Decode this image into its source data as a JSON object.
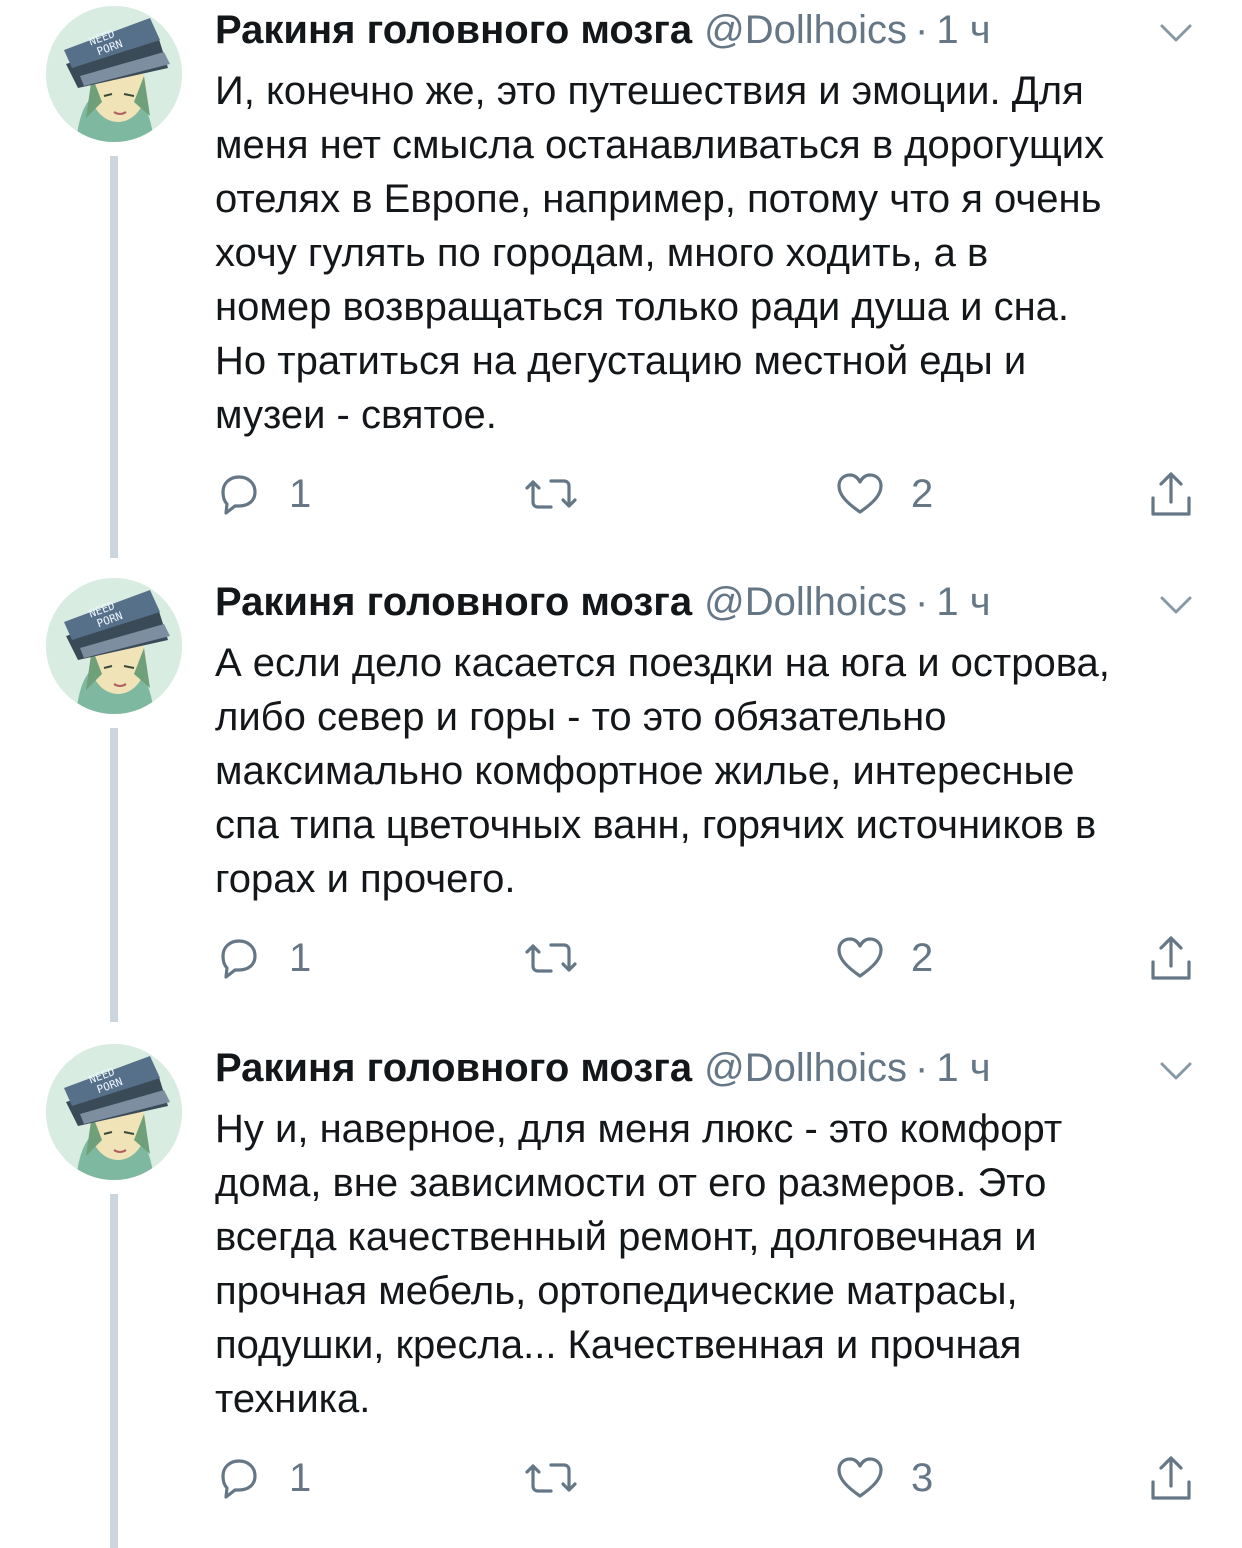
{
  "colors": {
    "text": "#14171a",
    "secondary": "#657786",
    "thread_line": "#cdd6dd"
  },
  "tweets": [
    {
      "author": "Ракиня головного мозга",
      "handle": "@Dollhoics",
      "separator": "·",
      "time": "1 ч",
      "text_lines": [
        "И, конечно же, это путешествия и эмоции. Для",
        "меня нет смысла останавливаться в дорогущих",
        "отелях в Европе, например, потому что я очень",
        "хочу гулять по городам, много ходить, а в",
        "номер возвращаться только ради душа и сна.",
        "Но тратиться на дегустацию местной еды и",
        "музеи - святое."
      ],
      "replies": "1",
      "likes": "2",
      "avatar_cap_text": [
        "NEED",
        "PORN"
      ]
    },
    {
      "author": "Ракиня головного мозга",
      "handle": "@Dollhoics",
      "separator": "·",
      "time": "1 ч",
      "text_lines": [
        "А если дело касается поездки на юга и острова,",
        "либо север и горы - то это обязательно",
        "максимально комфортное жилье, интересные",
        "спа типа цветочных ванн, горячих источников в",
        "горах и прочего."
      ],
      "replies": "1",
      "likes": "2",
      "avatar_cap_text": [
        "NEED",
        "PORN"
      ]
    },
    {
      "author": "Ракиня головного мозга",
      "handle": "@Dollhoics",
      "separator": "·",
      "time": "1 ч",
      "text_lines": [
        "Ну и, наверное, для меня люкс - это комфорт",
        "дома, вне зависимости от его размеров. Это",
        "всегда качественный ремонт, долговечная и",
        "прочная мебель, ортопедические матрасы,",
        "подушки, кресла... Качественная и прочная",
        "техника."
      ],
      "replies": "1",
      "likes": "3",
      "avatar_cap_text": [
        "NEED",
        "PORN"
      ]
    }
  ],
  "icons": {
    "reply": "reply-icon",
    "retweet": "retweet-icon",
    "like": "heart-icon",
    "share": "share-icon",
    "menu": "chevron-down-icon"
  }
}
